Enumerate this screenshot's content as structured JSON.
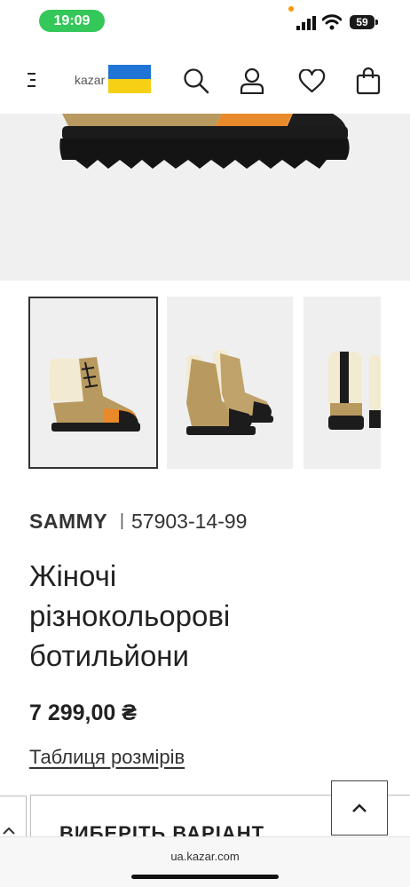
{
  "status_bar": {
    "time": "19:09",
    "battery": "59"
  },
  "header": {
    "logo_text": "kazar"
  },
  "product": {
    "brand": "SAMMY",
    "separator": "|",
    "sku": "57903-14-99",
    "title_lines": [
      "Жіночі",
      "різнокольорові",
      "ботильйони"
    ],
    "price": "7 299,00 ₴",
    "size_table_link": "Таблиця розмірів",
    "variant_button": "ВИБЕРІТЬ ВАРІАНТ"
  },
  "browser": {
    "url": "ua.kazar.com"
  },
  "colors": {
    "accent_green": "#34c759",
    "flag_blue": "#1f74d6",
    "flag_yellow": "#f5d015"
  }
}
